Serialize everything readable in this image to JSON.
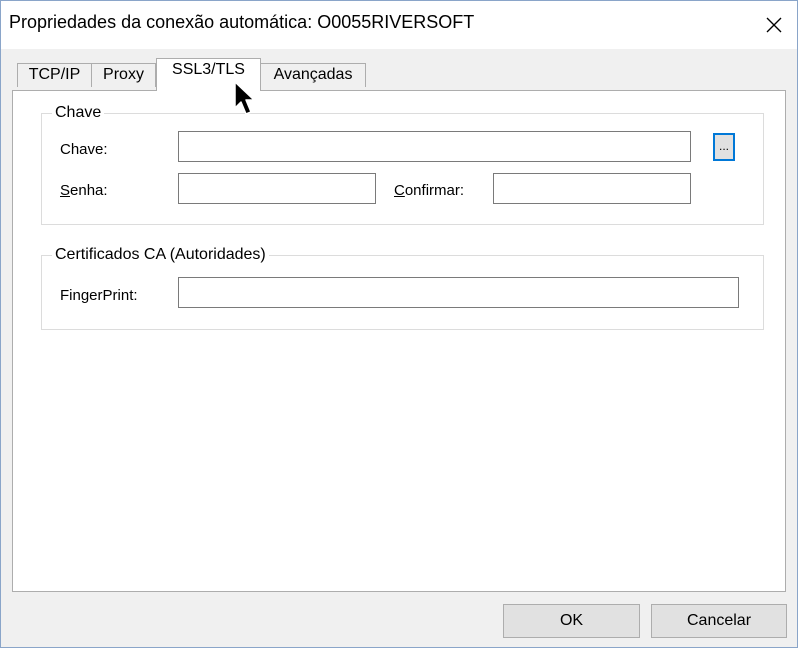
{
  "window": {
    "title": "Propriedades da conexão automática: O0055RIVERSOFT",
    "close_glyph": "✕"
  },
  "tabs": [
    {
      "label": "TCP/IP",
      "active": false
    },
    {
      "label": "Proxy",
      "active": false
    },
    {
      "label": "SSL3/TLS",
      "active": true
    },
    {
      "label": "Avançadas",
      "active": false
    }
  ],
  "chave_group": {
    "legend": "Chave",
    "chave_label": "Chave:",
    "chave_value": "",
    "browse_label": "...",
    "senha_label_underlined": "S",
    "senha_label_rest": "enha:",
    "senha_value": "",
    "confirmar_label_underlined": "C",
    "confirmar_label_rest": "onfirmar:",
    "confirmar_value": ""
  },
  "ca_group": {
    "legend": "Certificados CA (Autoridades)",
    "fingerprint_label": "FingerPrint:",
    "fingerprint_value": ""
  },
  "buttons": {
    "ok": "OK",
    "cancel": "Cancelar"
  },
  "icons": {
    "close": "close-icon",
    "cursor": "mouse-pointer-icon"
  },
  "colors": {
    "focus_border": "#0078d7",
    "window_bg": "#f0f0f0",
    "panel_bg": "#ffffff"
  }
}
